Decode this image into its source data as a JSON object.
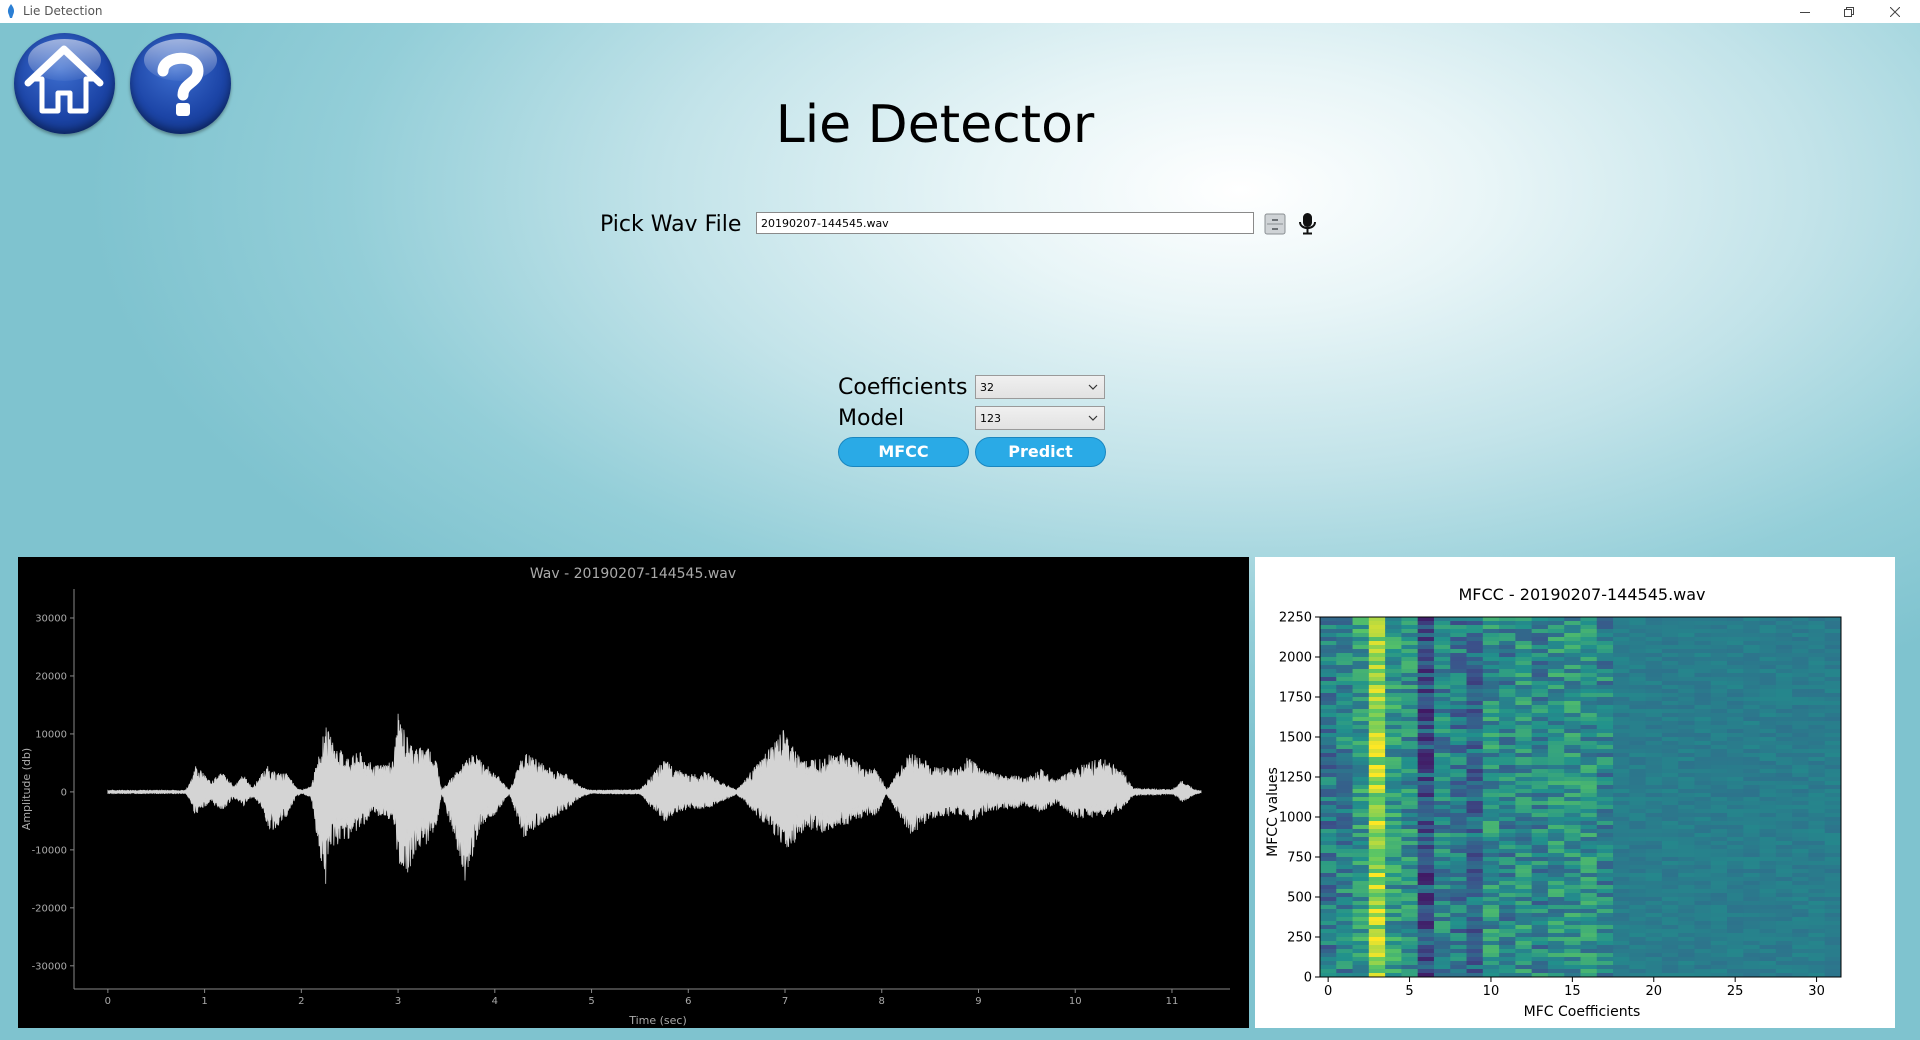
{
  "window": {
    "title": "Lie Detection"
  },
  "page": {
    "title": "Lie Detector"
  },
  "file_picker": {
    "label": "Pick Wav File",
    "value": "20190207-144545.wav"
  },
  "controls": {
    "coefficients_label": "Coefficients",
    "coefficients_value": "32",
    "model_label": "Model",
    "model_value": "123",
    "mfcc_button": "MFCC",
    "predict_button": "Predict"
  },
  "colors": {
    "accent": "#2aaae6",
    "nav_button": "#1d46a8",
    "waveform": "#d4d4d4"
  },
  "icons": [
    "home-icon",
    "help-icon",
    "file-browse-icon",
    "microphone-icon",
    "minimize-icon",
    "restore-icon",
    "close-icon"
  ],
  "chart_data": [
    {
      "type": "line",
      "title": "Wav - 20190207-144545.wav",
      "xlabel": "Time (sec)",
      "ylabel": "Amplitude (db)",
      "xlim": [
        -0.35,
        11.6
      ],
      "ylim": [
        -34000,
        35000
      ],
      "xticks": [
        "0",
        "1",
        "2",
        "3",
        "4",
        "5",
        "6",
        "7",
        "8",
        "9",
        "10",
        "11"
      ],
      "yticks": [
        "30000",
        "20000",
        "10000",
        "0",
        "-10000",
        "-20000",
        "-30000"
      ],
      "envelope": {
        "t": [
          0.0,
          0.8,
          0.85,
          0.9,
          1.05,
          1.2,
          1.3,
          1.4,
          1.5,
          1.6,
          1.65,
          1.7,
          1.85,
          1.95,
          2.0,
          2.1,
          2.25,
          2.28,
          2.35,
          2.5,
          2.6,
          2.75,
          2.95,
          3.0,
          3.1,
          3.2,
          3.3,
          3.4,
          3.45,
          3.7,
          3.8,
          3.85,
          4.0,
          4.15,
          4.3,
          4.45,
          4.6,
          4.75,
          4.9,
          5.0,
          5.5,
          5.7,
          5.75,
          5.85,
          6.0,
          6.2,
          6.3,
          6.5,
          7.0,
          7.05,
          7.2,
          7.4,
          7.6,
          7.8,
          7.95,
          8.05,
          8.2,
          8.3,
          8.4,
          8.55,
          8.8,
          8.9,
          9.0,
          9.1,
          9.3,
          9.5,
          9.65,
          9.8,
          10.0,
          10.3,
          10.5,
          10.6,
          11.0,
          11.05,
          11.1,
          11.2,
          11.25,
          11.3
        ],
        "max": [
          300,
          300,
          1500,
          5000,
          2000,
          3500,
          1000,
          3000,
          800,
          3500,
          4500,
          3500,
          3200,
          800,
          300,
          900,
          11500,
          10500,
          8000,
          6000,
          7000,
          4500,
          5500,
          13500,
          9500,
          7500,
          8500,
          5500,
          300,
          5500,
          7000,
          5500,
          3500,
          300,
          7000,
          5500,
          4000,
          3000,
          800,
          300,
          400,
          4500,
          5500,
          4500,
          3000,
          3500,
          2000,
          400,
          11000,
          8500,
          5500,
          6500,
          7000,
          4500,
          4000,
          400,
          4500,
          7000,
          6000,
          4500,
          4000,
          6500,
          4500,
          3500,
          3000,
          2500,
          4000,
          2000,
          4500,
          6000,
          3500,
          600,
          400,
          1000,
          2000,
          800,
          400,
          200
        ],
        "min": [
          -300,
          -300,
          -1500,
          -4000,
          -2000,
          -3200,
          -1000,
          -2500,
          -800,
          -3000,
          -6000,
          -7000,
          -4500,
          -800,
          -300,
          -1000,
          -17500,
          -10000,
          -9500,
          -8000,
          -6500,
          -4000,
          -5000,
          -12500,
          -14000,
          -10000,
          -9000,
          -6000,
          -300,
          -16000,
          -9000,
          -6000,
          -4000,
          -300,
          -8000,
          -6000,
          -4500,
          -3000,
          -800,
          -300,
          -400,
          -4500,
          -5500,
          -4000,
          -3000,
          -3000,
          -2000,
          -400,
          -9500,
          -10000,
          -6500,
          -7000,
          -6000,
          -4500,
          -4000,
          -400,
          -5000,
          -8000,
          -6000,
          -4500,
          -4000,
          -5000,
          -4500,
          -3500,
          -3000,
          -2500,
          -3500,
          -2000,
          -4500,
          -4500,
          -3000,
          -600,
          -400,
          -800,
          -2000,
          -800,
          -400,
          -200
        ]
      }
    },
    {
      "type": "heatmap",
      "title": "MFCC - 20190207-144545.wav",
      "xlabel": "MFC Coefficients",
      "ylabel": "MFCC values",
      "xlim": [
        -0.5,
        31.5
      ],
      "ylim": [
        0,
        2250
      ],
      "xticks": [
        "0",
        "5",
        "10",
        "15",
        "20",
        "25",
        "30"
      ],
      "yticks": [
        "0",
        "250",
        "500",
        "750",
        "1000",
        "1250",
        "1500",
        "1750",
        "2000",
        "2250"
      ],
      "columns": 32,
      "rows": 2250,
      "column_mean_intensity": [
        0.4,
        0.45,
        0.55,
        0.85,
        0.55,
        0.5,
        0.25,
        0.45,
        0.4,
        0.35,
        0.5,
        0.45,
        0.5,
        0.45,
        0.5,
        0.5,
        0.5,
        0.45,
        0.42,
        0.42,
        0.42,
        0.42,
        0.42,
        0.42,
        0.42,
        0.42,
        0.42,
        0.42,
        0.42,
        0.42,
        0.42,
        0.42
      ],
      "colormap": "viridis"
    }
  ]
}
